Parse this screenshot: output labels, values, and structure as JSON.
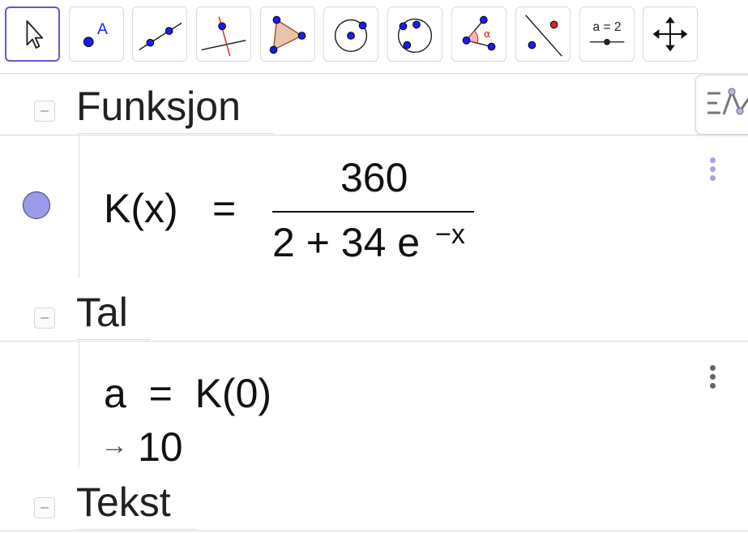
{
  "toolbar": {
    "tools": [
      {
        "icon": "pointer-arrow-icon"
      },
      {
        "icon": "point-icon",
        "label": "A"
      },
      {
        "icon": "line-through-two-points-icon"
      },
      {
        "icon": "perpendicular-line-icon"
      },
      {
        "icon": "polygon-icon"
      },
      {
        "icon": "circle-with-center-icon"
      },
      {
        "icon": "circle-through-three-points-icon"
      },
      {
        "icon": "angle-icon",
        "label": "α"
      },
      {
        "icon": "reflect-about-line-icon"
      },
      {
        "icon": "slider-icon",
        "label": "a = 2"
      },
      {
        "icon": "move-graphics-view-icon"
      }
    ]
  },
  "algebra": {
    "groups": [
      {
        "title": "Funksjon",
        "entry": {
          "lhs": "K(x)",
          "equals": "=",
          "numerator": "360",
          "denominator": "2 + 34 e",
          "exponent": "−x"
        }
      },
      {
        "title": "Tal",
        "entry": {
          "input": "a  =  K(0)",
          "arrow": "→",
          "output": "10"
        }
      },
      {
        "title": "Tekst"
      }
    ]
  },
  "colors": {
    "accent": "#6557d2",
    "marble": "#9a9aea",
    "point_blue": "#1a1aff",
    "angle_red": "#e02020"
  }
}
